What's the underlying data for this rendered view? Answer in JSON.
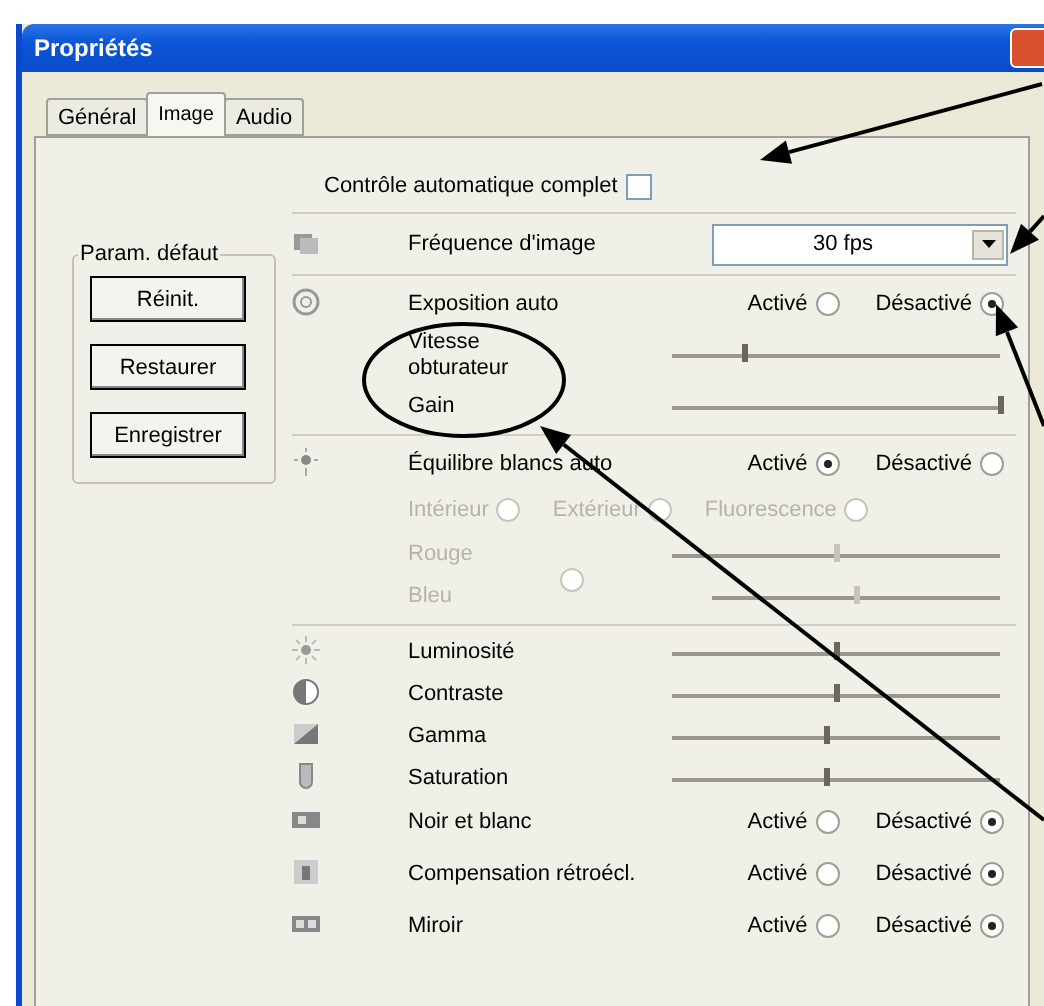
{
  "window": {
    "title": "Propriétés"
  },
  "tabs": [
    {
      "label": "Général",
      "selected": false
    },
    {
      "label": "Image",
      "selected": true
    },
    {
      "label": "Audio",
      "selected": false
    }
  ],
  "auto_control": {
    "label": "Contrôle automatique complet",
    "checked": false
  },
  "defaults": {
    "title": "Param. défaut",
    "buttons": [
      "Réinit.",
      "Restaurer",
      "Enregistrer"
    ]
  },
  "groups": [
    [
      {
        "kind": "dropdown",
        "label": "Fréquence d'image",
        "value": "30 fps"
      }
    ],
    [
      {
        "kind": "toggle",
        "label": "Exposition auto",
        "options": [
          {
            "label": "Activé",
            "selected": false
          },
          {
            "label": "Désactivé",
            "selected": true
          }
        ]
      },
      {
        "kind": "slider",
        "label": "Vitesse obturateur",
        "level": 0.22,
        "disabled": false
      },
      {
        "kind": "slider",
        "label": "Gain",
        "level": 1.0,
        "disabled": false
      }
    ],
    [
      {
        "kind": "toggle",
        "label": "Équilibre blancs auto",
        "options": [
          {
            "label": "Activé",
            "selected": true
          },
          {
            "label": "Désactivé",
            "selected": false
          }
        ]
      },
      {
        "kind": "modes",
        "options": [
          {
            "label": "Intérieur",
            "selected": false
          },
          {
            "label": "Extérieur",
            "selected": false
          },
          {
            "label": "Fluorescence",
            "selected": false
          }
        ],
        "disabled": true
      },
      {
        "kind": "slider",
        "label": "Rouge",
        "level": 0.5,
        "disabled": true
      },
      {
        "kind": "slider",
        "label": "Bleu",
        "level": 0.5,
        "disabled": true,
        "radio": {
          "selected": false
        }
      }
    ],
    [
      {
        "kind": "slider",
        "label": "Luminosité",
        "level": 0.5,
        "disabled": false
      },
      {
        "kind": "slider",
        "label": "Contraste",
        "level": 0.5,
        "disabled": false
      },
      {
        "kind": "slider",
        "label": "Gamma",
        "level": 0.47,
        "disabled": false
      },
      {
        "kind": "slider",
        "label": "Saturation",
        "level": 0.47,
        "disabled": false
      },
      {
        "kind": "toggle",
        "label": "Noir et blanc",
        "options": [
          {
            "label": "Activé",
            "selected": false
          },
          {
            "label": "Désactivé",
            "selected": true
          }
        ]
      },
      {
        "kind": "toggle",
        "label": "Compensation rétroécl.",
        "options": [
          {
            "label": "Activé",
            "selected": false
          },
          {
            "label": "Désactivé",
            "selected": true
          }
        ]
      },
      {
        "kind": "toggle",
        "label": "Miroir",
        "options": [
          {
            "label": "Activé",
            "selected": false
          },
          {
            "label": "Désactivé",
            "selected": true
          }
        ]
      }
    ]
  ]
}
